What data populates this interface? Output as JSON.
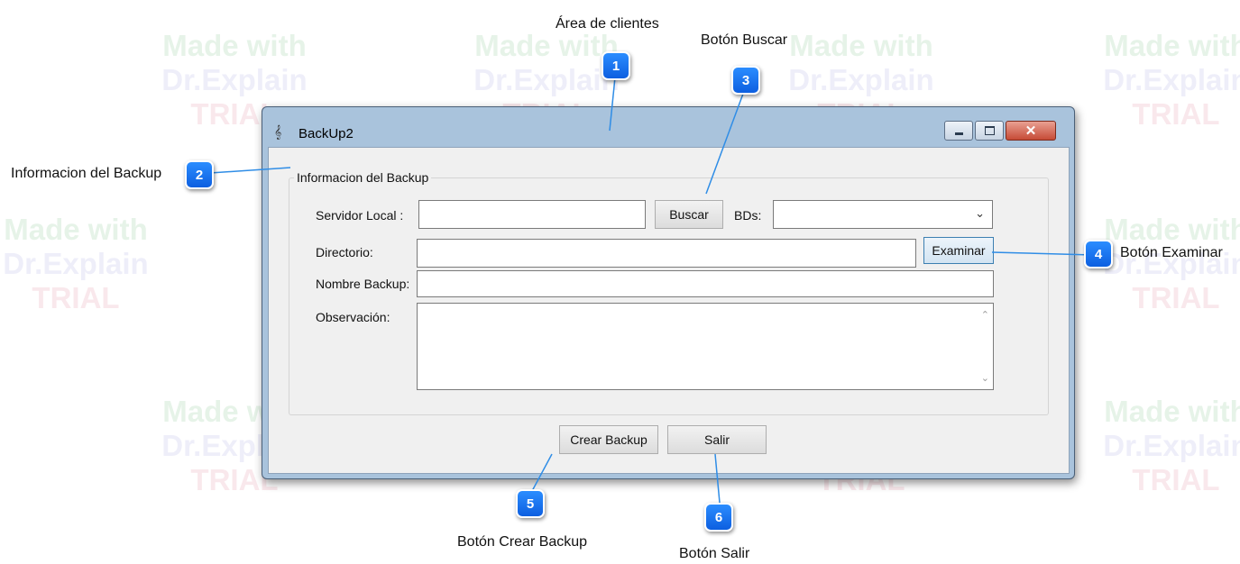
{
  "watermark": {
    "line1": "Made with",
    "line2": "Dr.Explain",
    "line3": "TRIAL"
  },
  "window": {
    "title": "BackUp2",
    "icon": "app-icon",
    "controls": [
      "minimize-icon",
      "maximize-icon",
      "close-icon"
    ]
  },
  "group": {
    "legend": "Informacion del Backup",
    "servidor_label": "Servidor Local :",
    "servidor_value": "",
    "buscar_label": "Buscar",
    "bds_label": "BDs:",
    "bds_value": "",
    "directorio_label": "Directorio:",
    "directorio_value": "",
    "examinar_label": "Examinar",
    "nombre_label": "Nombre Backup:",
    "nombre_value": "",
    "observacion_label": "Observación:",
    "observacion_value": ""
  },
  "footer": {
    "crear_label": "Crear Backup",
    "salir_label": "Salir"
  },
  "callouts": [
    {
      "number": "1",
      "label": "Área de clientes"
    },
    {
      "number": "2",
      "label": "Informacion del Backup"
    },
    {
      "number": "3",
      "label": "Botón Buscar"
    },
    {
      "number": "4",
      "label": "Botón Examinar"
    },
    {
      "number": "5",
      "label": "Botón Crear Backup"
    },
    {
      "number": "6",
      "label": "Botón Salir"
    }
  ],
  "colors": {
    "badge": "#1a73f0",
    "connector": "#2f8de6",
    "titlebar": "#a9c3dc",
    "close": "#c64b36"
  }
}
